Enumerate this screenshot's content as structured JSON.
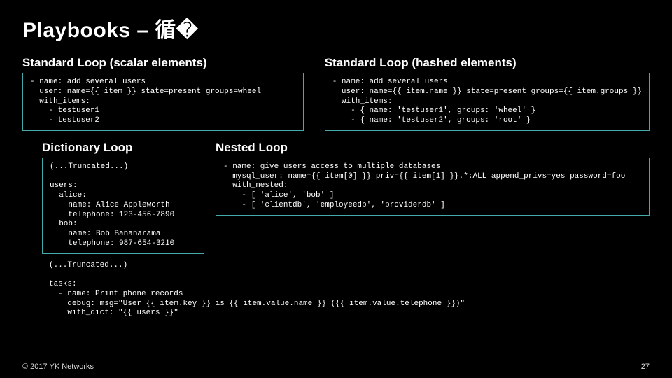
{
  "title": "Playbooks – 循�",
  "sections": {
    "scalar": {
      "heading": "Standard Loop (scalar elements)",
      "code": "- name: add several users\n  user: name={{ item }} state=present groups=wheel\n  with_items:\n    - testuser1\n    - testuser2"
    },
    "hashed": {
      "heading": "Standard Loop (hashed elements)",
      "code": "- name: add several users\n  user: name={{ item.name }} state=present groups={{ item.groups }}\n  with_items:\n    - { name: 'testuser1', groups: 'wheel' }\n    - { name: 'testuser2', groups: 'root' }"
    },
    "dict": {
      "heading": "Dictionary Loop",
      "code": "(...Truncated...)\n\nusers:\n  alice:\n    name: Alice Appleworth\n    telephone: 123-456-7890\n  bob:\n    name: Bob Bananarama\n    telephone: 987-654-3210"
    },
    "nested": {
      "heading": "Nested Loop",
      "code": "- name: give users access to multiple databases\n  mysql_user: name={{ item[0] }} priv={{ item[1] }}.*:ALL append_privs=yes password=foo\n  with_nested:\n    - [ 'alice', 'bob' ]\n    - [ 'clientdb', 'employeedb', 'providerdb' ]"
    },
    "tail": {
      "code": "(...Truncated...)\n\ntasks:\n  - name: Print phone records\n    debug: msg=\"User {{ item.key }} is {{ item.value.name }} ({{ item.value.telephone }})\"\n    with_dict: \"{{ users }}\""
    }
  },
  "footer": {
    "copyright": "© 2017 YK Networks",
    "page": "27"
  }
}
